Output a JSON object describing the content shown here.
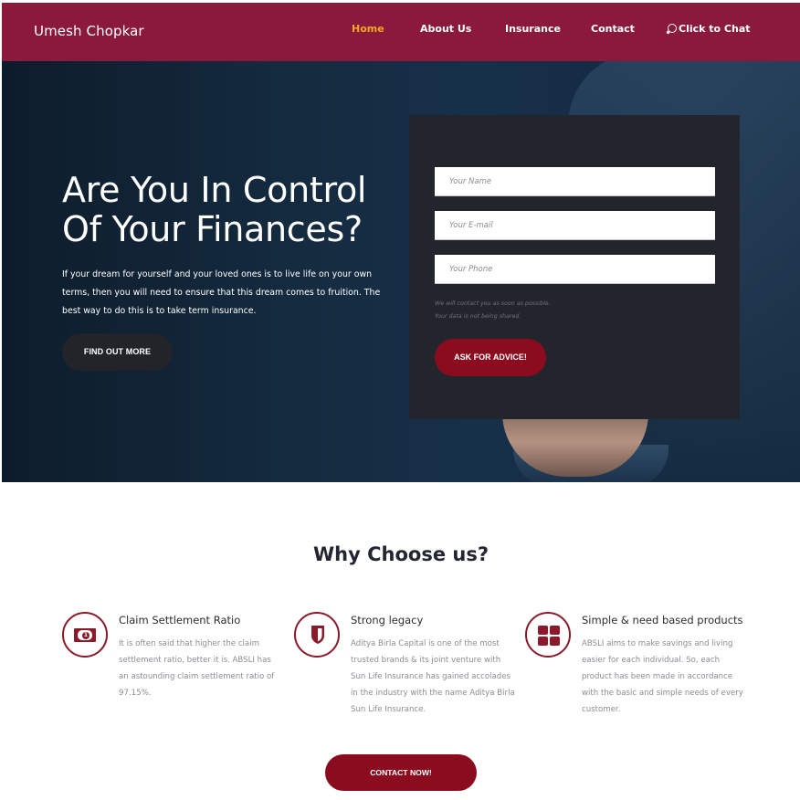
{
  "nav": {
    "brand": "Umesh Chopkar",
    "items": [
      {
        "label": "Home",
        "active": true
      },
      {
        "label": "About Us",
        "active": false
      },
      {
        "label": "Insurance",
        "active": false
      },
      {
        "label": "Contact",
        "active": false
      },
      {
        "label": "Click to Chat",
        "icon": "whatsapp-icon",
        "active": false
      }
    ]
  },
  "hero": {
    "title_line1": "Are You In Control",
    "title_line2": "Of Your Finances?",
    "text": "If your dream for yourself and your loved ones is to live life on your own terms, then you will need to ensure that this dream comes to fruition. The best way to do this is to take term insurance.",
    "cta_label": "FIND OUT MORE"
  },
  "form": {
    "name_placeholder": "Your Name",
    "email_placeholder": "Your E-mail",
    "phone_placeholder": "Your Phone",
    "note_1": "We will contact you as soon as possible.",
    "note_2": "Your data is not being shared.",
    "submit_label": "ASK FOR ADVICE!"
  },
  "why": {
    "title": "Why Choose us?",
    "features": [
      {
        "icon": "money-bill-icon",
        "title": "Claim Settlement Ratio",
        "description": "It is often said that higher the claim settlement ratio, better it is. ABSLI has an astounding claim settlement ratio of 97.15%."
      },
      {
        "icon": "shield-icon",
        "title": "Strong legacy",
        "description": "Aditya Birla Capital is one of the most trusted brands & its joint venture with Sun Life Insurance has gained accolades in the industry with the name Aditya Birla Sun Life Insurance."
      },
      {
        "icon": "grid-icon",
        "title": "Simple & need based products",
        "description": "ABSLI aims to make savings and living easier for each individual. So, each product has been made in accordance with the basic and simple needs of every customer."
      }
    ],
    "cta_label": "CONTACT NOW!"
  },
  "colors": {
    "brand_maroon": "#8b193b",
    "button_red": "#8b0c1f",
    "nav_active": "#f5a623",
    "form_bg": "#22252c",
    "dark_button": "#232429"
  }
}
